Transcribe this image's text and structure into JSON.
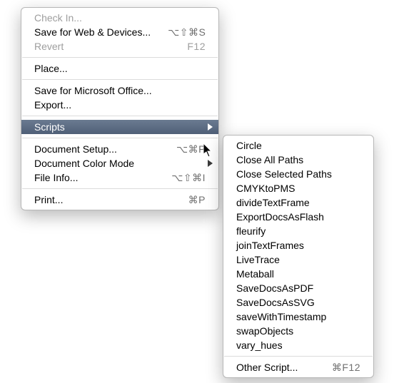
{
  "main_menu": {
    "check_in": "Check In...",
    "save_web": "Save for Web & Devices...",
    "save_web_shortcut": "⌥⇧⌘S",
    "revert": "Revert",
    "revert_shortcut": "F12",
    "place": "Place...",
    "save_ms": "Save for Microsoft Office...",
    "export": "Export...",
    "scripts": "Scripts",
    "doc_setup": "Document Setup...",
    "doc_setup_shortcut": "⌥⌘P",
    "color_mode": "Document Color Mode",
    "file_info": "File Info...",
    "file_info_shortcut": "⌥⇧⌘I",
    "print": "Print...",
    "print_shortcut": "⌘P"
  },
  "scripts_menu": {
    "items": [
      "Circle",
      "Close All Paths",
      "Close Selected Paths",
      "CMYKtoPMS",
      "divideTextFrame",
      "ExportDocsAsFlash",
      "fleurify",
      "joinTextFrames",
      "LiveTrace",
      "Metaball",
      "SaveDocsAsPDF",
      "SaveDocsAsSVG",
      "saveWithTimestamp",
      "swapObjects",
      "vary_hues"
    ],
    "other": "Other Script...",
    "other_shortcut": "⌘F12"
  }
}
